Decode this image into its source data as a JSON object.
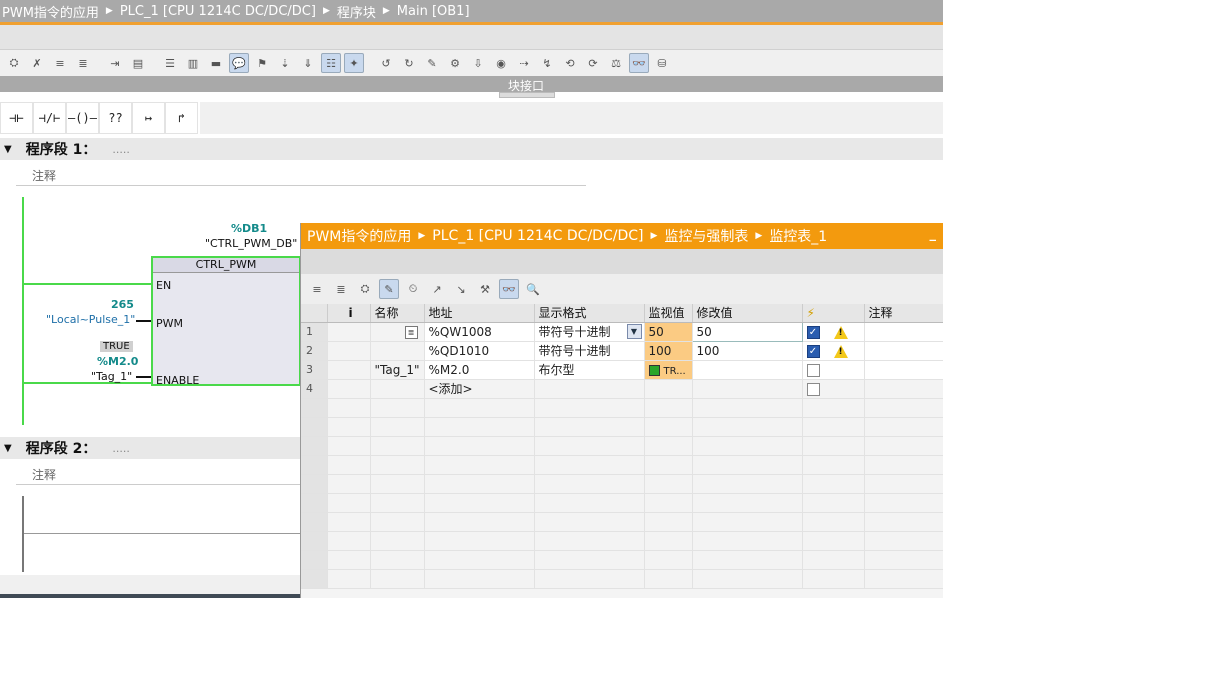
{
  "editor": {
    "breadcrumb": [
      "PWM指令的应用",
      "PLC_1 [CPU 1214C DC/DC/DC]",
      "程序块",
      "Main [OB1]"
    ],
    "interface_label": "块接口",
    "ladder_buttons": [
      "⊣⊢",
      "⊣/⊢",
      "–()–",
      "??",
      "↦",
      "↱"
    ],
    "network1": {
      "title": "程序段 1：",
      "dots": ".....",
      "comment": "注释"
    },
    "network2": {
      "title": "程序段 2：",
      "dots": ".....",
      "comment": "注释"
    },
    "block": {
      "db": "%DB1",
      "db_name": "\"CTRL_PWM_DB\"",
      "name": "CTRL_PWM",
      "pin_en": "EN",
      "pin_pwm": "PWM",
      "pin_enable": "ENABLE",
      "pwm_value": "265",
      "pwm_tag": "\"Local~Pulse_1\"",
      "enable_state": "TRUE",
      "enable_addr": "%M2.0",
      "enable_tag": "\"Tag_1\""
    }
  },
  "watch": {
    "breadcrumb": [
      "PWM指令的应用",
      "PLC_1 [CPU 1214C DC/DC/DC]",
      "监控与强制表",
      "监控表_1"
    ],
    "minimize": "_",
    "columns": [
      "",
      "i",
      "名称",
      "地址",
      "显示格式",
      "监视值",
      "修改值",
      "⚡",
      "注释"
    ],
    "rows": [
      {
        "num": "1",
        "name": "",
        "address": "%QW1008",
        "format": "带符号十进制",
        "monitor": "50",
        "modify": "50",
        "checked": true,
        "warn": true
      },
      {
        "num": "2",
        "name": "",
        "address": "%QD1010",
        "format": "带符号十进制",
        "monitor": "100",
        "modify": "100",
        "checked": true,
        "warn": true
      },
      {
        "num": "3",
        "name": "\"Tag_1\"",
        "address": "%M2.0",
        "format": "布尔型",
        "monitor": "TR...",
        "modify": "",
        "checked": false,
        "warn": false
      },
      {
        "num": "4",
        "name": "",
        "address": "<添加>",
        "format": "",
        "monitor": "",
        "modify": "",
        "checked": false,
        "warn": false
      }
    ]
  }
}
